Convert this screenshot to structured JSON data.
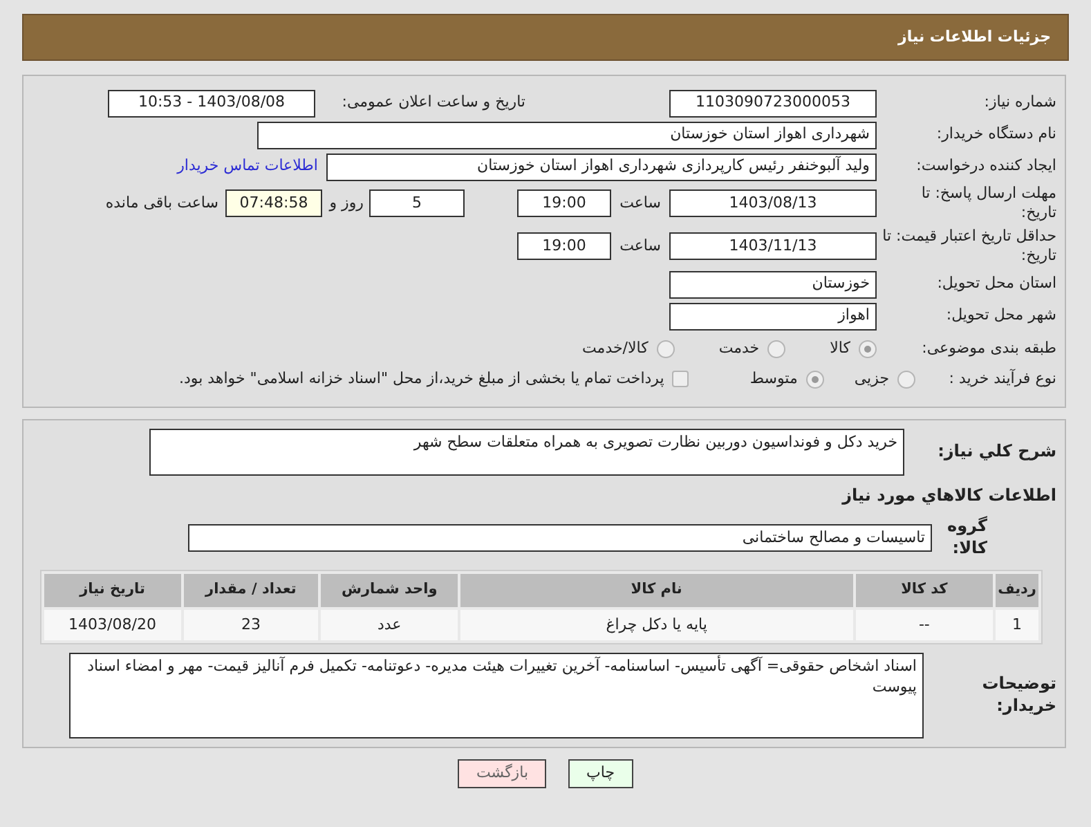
{
  "header": {
    "title": "جزئیات اطلاعات نیاز"
  },
  "need_number": {
    "label": "شماره نیاز:",
    "value": "1103090723000053"
  },
  "announce": {
    "label": "تاریخ و ساعت اعلان عمومی:",
    "value": "1403/08/08 - 10:53"
  },
  "buyer_org": {
    "label": "نام دستگاه خریدار:",
    "value": "شهرداری اهواز استان خوزستان"
  },
  "requester": {
    "label": "ایجاد کننده درخواست:",
    "value": "ولید آلبوخنفر رئیس کارپردازی شهرداری اهواز استان خوزستان"
  },
  "contact_link": {
    "text": "اطلاعات تماس خریدار"
  },
  "response_deadline": {
    "label": "مهلت ارسال پاسخ: تا تاریخ:",
    "date": "1403/08/13",
    "time_label": "ساعت",
    "time": "19:00",
    "days": "5",
    "days_label": "روز و",
    "remaining": "07:48:58",
    "remaining_label": "ساعت باقی مانده"
  },
  "price_validity": {
    "label": "حداقل تاریخ اعتبار قیمت: تا تاریخ:",
    "date": "1403/11/13",
    "time_label": "ساعت",
    "time": "19:00"
  },
  "province": {
    "label": "استان محل تحویل:",
    "value": "خوزستان"
  },
  "city": {
    "label": "شهر محل تحویل:",
    "value": "اهواز"
  },
  "category": {
    "label": "طبقه بندی موضوعی:",
    "options": [
      {
        "label": "کالا",
        "selected": true
      },
      {
        "label": "خدمت",
        "selected": false
      },
      {
        "label": "کالا/خدمت",
        "selected": false
      }
    ]
  },
  "purchase_type": {
    "label": "نوع فرآیند خرید :",
    "options": [
      {
        "label": "جزیی",
        "selected": false
      },
      {
        "label": "متوسط",
        "selected": true
      }
    ],
    "payment_checkbox": {
      "label": "پرداخت تمام یا بخشی از مبلغ خرید،از محل \"اسناد خزانه اسلامی\" خواهد بود.",
      "checked": false
    }
  },
  "description": {
    "label": "شرح کلي نياز:",
    "value": "خرید دکل و فونداسیون دوربین نظارت تصویری به همراه متعلقات سطح شهر"
  },
  "goods_heading": "اطلاعات کالاهاي مورد نياز",
  "goods_group": {
    "label": "گروه کالا:",
    "value": "تاسیسات و مصالح ساختمانی"
  },
  "table": {
    "columns": [
      "ردیف",
      "کد کالا",
      "نام کالا",
      "واحد شمارش",
      "تعداد / مقدار",
      "تاریخ نیاز"
    ],
    "rows": [
      [
        "1",
        "--",
        "پایه یا دکل چراغ",
        "عدد",
        "23",
        "1403/08/20"
      ]
    ]
  },
  "buyer_notes": {
    "label": "توضیحات خریدار:",
    "value": "اسناد اشخاص حقوقی= آگهی تأسیس- اساسنامه- آخرین تغییرات هیئت مدیره- دعوتنامه- تکمیل فرم آنالیز قیمت- مهر و امضاء اسناد پیوست"
  },
  "buttons": [
    {
      "label": "چاپ",
      "kind": "print"
    },
    {
      "label": "بازگشت",
      "kind": "back"
    }
  ]
}
